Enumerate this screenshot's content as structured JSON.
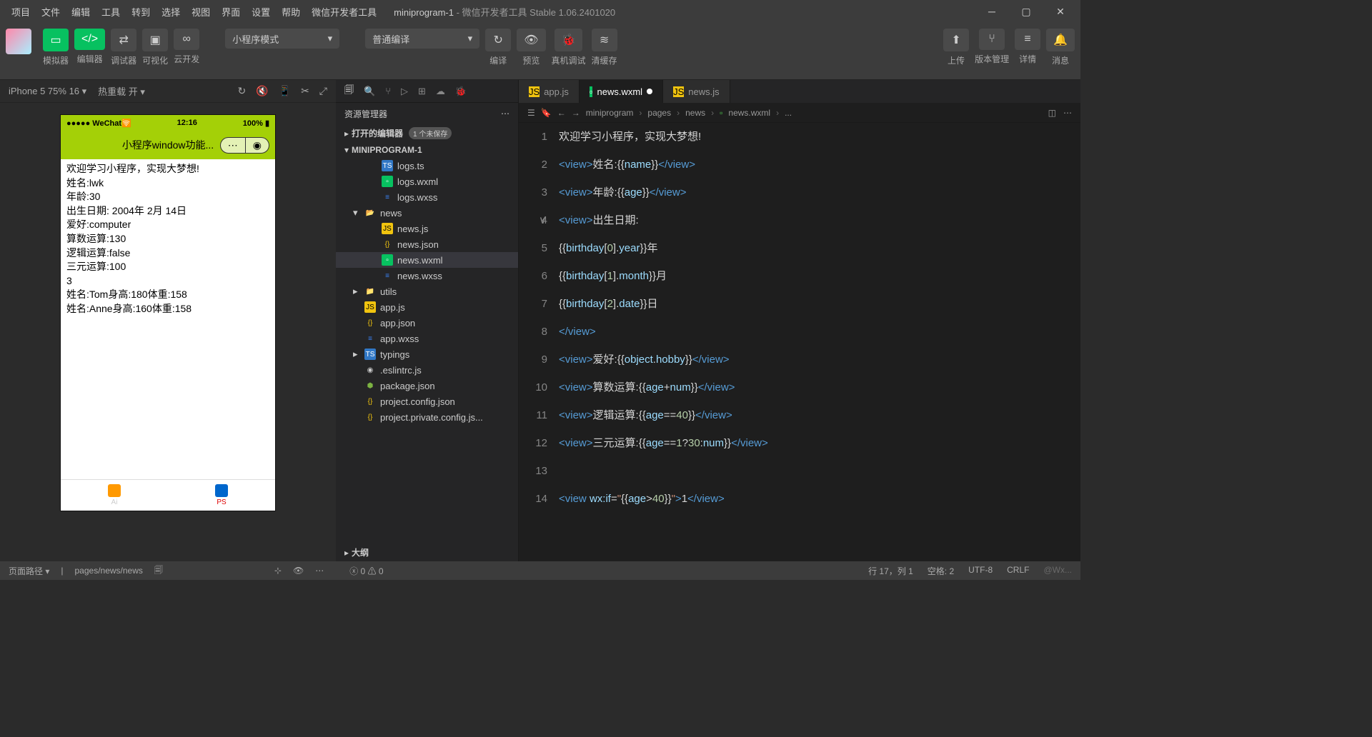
{
  "titlebar": {
    "menus": [
      "项目",
      "文件",
      "编辑",
      "工具",
      "转到",
      "选择",
      "视图",
      "界面",
      "设置",
      "帮助",
      "微信开发者工具"
    ],
    "project": "miniprogram-1",
    "subtitle": " - 微信开发者工具 Stable 1.06.2401020"
  },
  "toolbar": {
    "simulator": "模拟器",
    "editor": "编辑器",
    "debugger": "调试器",
    "visual": "可视化",
    "cloud": "云开发",
    "mode": "小程序模式",
    "compile_mode": "普通编译",
    "compile": "编译",
    "preview": "预览",
    "remote": "真机调试",
    "clear": "清缓存",
    "upload": "上传",
    "version": "版本管理",
    "detail": "详情",
    "message": "消息"
  },
  "sim_toolbar": {
    "device": "iPhone 5 75% 16",
    "hotreload": "热重载 开"
  },
  "phone": {
    "carrier": "WeChat",
    "time": "12:16",
    "battery": "100%",
    "title": "小程序window功能...",
    "lines": [
      "欢迎学习小程序，实现大梦想!",
      "姓名:lwk",
      "年龄:30",
      "出生日期: 2004年 2月 14日",
      "爱好:computer",
      "算数运算:130",
      "逻辑运算:false",
      "三元运算:100",
      "3",
      "姓名:Tom身高:180体重:158",
      "姓名:Anne身高:160体重:158"
    ],
    "tab_ai": "Ai",
    "tab_ps": "PS"
  },
  "explorer": {
    "title": "资源管理器",
    "open_editors": "打开的编辑器",
    "unsaved": "1 个未保存",
    "root": "MINIPROGRAM-1",
    "outline": "大纲",
    "items": [
      {
        "lvl": 2,
        "icon": "ts",
        "name": "logs.ts"
      },
      {
        "lvl": 2,
        "icon": "wxml",
        "name": "logs.wxml"
      },
      {
        "lvl": 2,
        "icon": "wxss",
        "name": "logs.wxss"
      },
      {
        "lvl": 1,
        "icon": "folder-open",
        "name": "news",
        "arrow": "▾"
      },
      {
        "lvl": 2,
        "icon": "js",
        "name": "news.js"
      },
      {
        "lvl": 2,
        "icon": "json",
        "name": "news.json"
      },
      {
        "lvl": 2,
        "icon": "wxml",
        "name": "news.wxml",
        "sel": true
      },
      {
        "lvl": 2,
        "icon": "wxss",
        "name": "news.wxss"
      },
      {
        "lvl": 1,
        "icon": "folder-g",
        "name": "utils",
        "arrow": "▸"
      },
      {
        "lvl": 1,
        "icon": "js",
        "name": "app.js"
      },
      {
        "lvl": 1,
        "icon": "json",
        "name": "app.json"
      },
      {
        "lvl": 1,
        "icon": "wxss",
        "name": "app.wxss"
      },
      {
        "lvl": 1,
        "icon": "ts",
        "name": "typings",
        "arrow": "▸"
      },
      {
        "lvl": 1,
        "icon": "eslint",
        "name": ".eslintrc.js"
      },
      {
        "lvl": 1,
        "icon": "npm",
        "name": "package.json"
      },
      {
        "lvl": 1,
        "icon": "json",
        "name": "project.config.json"
      },
      {
        "lvl": 1,
        "icon": "json",
        "name": "project.private.config.js..."
      }
    ]
  },
  "tabs": [
    {
      "icon": "js",
      "name": "app.js"
    },
    {
      "icon": "wxml",
      "name": "news.wxml",
      "active": true,
      "dirty": true
    },
    {
      "icon": "js",
      "name": "news.js"
    }
  ],
  "breadcrumb": [
    "miniprogram",
    "pages",
    "news",
    "news.wxml",
    "..."
  ],
  "code_lines": [
    1,
    2,
    3,
    4,
    5,
    6,
    7,
    8,
    9,
    10,
    11,
    12,
    13,
    14
  ],
  "status": {
    "path_label": "页面路径",
    "path": "pages/news/news",
    "errors": "0",
    "warnings": "0",
    "line": "行 17，列 1",
    "spaces": "空格: 2",
    "encoding": "UTF-8",
    "lang": "CRLF"
  }
}
